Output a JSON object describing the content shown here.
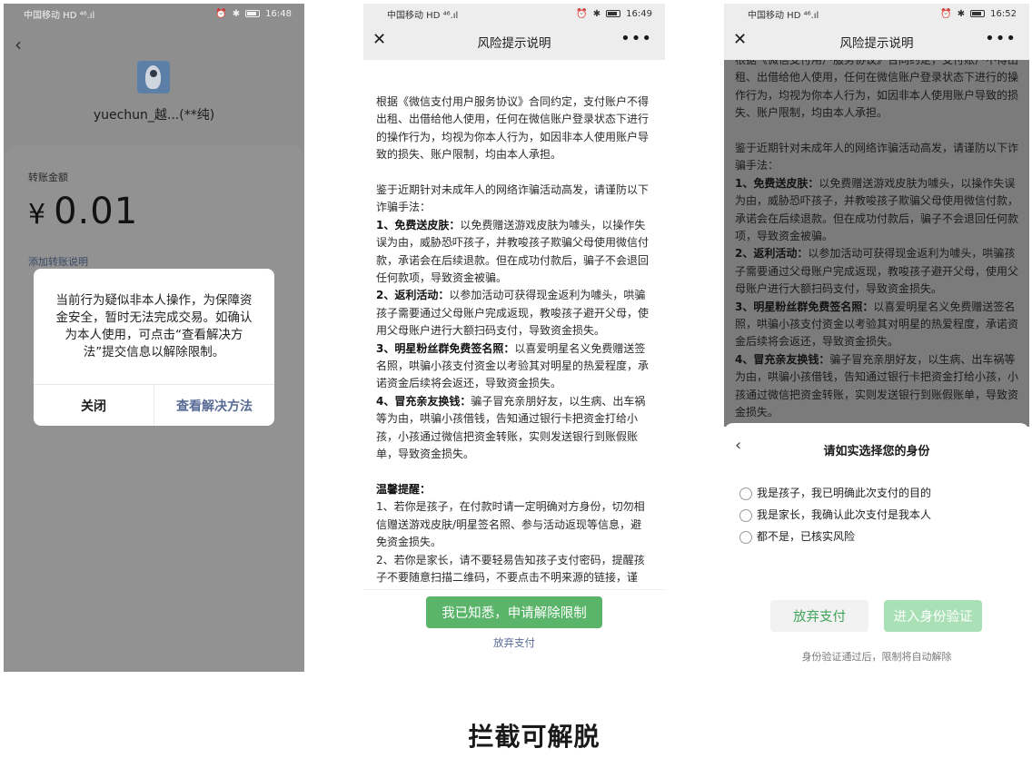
{
  "caption": "拦截可解脱",
  "phone1": {
    "status": {
      "carrier": "中国移动 HD ⁴⁶.ıl",
      "time": "16:48"
    },
    "payee_name": "yuechun_越...(**纯)",
    "amount_label": "转账金额",
    "amount_currency": "¥",
    "amount_value": "0.01",
    "add_note_link": "添加转账说明",
    "dialog": {
      "message": "当前行为疑似非本人操作，为保障资金安全，暂时无法完成交易。如确认为本人使用，可点击“查看解决方法”提交信息以解除限制。",
      "close_label": "关闭",
      "view_solution_label": "查看解决方法"
    }
  },
  "phone2": {
    "status": {
      "carrier": "中国移动 HD ⁴⁶.ıl",
      "time": "16:49"
    },
    "title": "风险提示说明",
    "more": "•••",
    "article": {
      "intro": "根据《微信支付用户服务协议》合同约定，支付账户不得出租、出借给他人使用，任何在微信账户登录状态下进行的操作行为，均视为你本人行为，如因非本人使用账户导致的损失、账户限制，均由本人承担。",
      "warn": "鉴于近期针对未成年人的网络诈骗活动高发，请谨防以下诈骗手法：",
      "item1_title": "1、免费送皮肤：",
      "item1_body": "以免费赠送游戏皮肤为噱头，以操作失误为由，威胁恐吓孩子，并教唆孩子欺骗父母使用微信付款，承诺会在后续退款。但在成功付款后，骗子不会退回任何款项，导致资金被骗。",
      "item2_title": "2、返利活动：",
      "item2_body": "以参加活动可获得现金返利为噱头，哄骗孩子需要通过父母账户完成返现，教唆孩子避开父母，使用父母账户进行大额扫码支付，导致资金损失。",
      "item3_title": "3、明星粉丝群免费签名照：",
      "item3_body": "以喜爱明星名义免费赠送签名照，哄骗小孩支付资金以考验其对明星的热爱程度，承诺资金后续将会返还，导致资金损失。",
      "item4_title": "4、冒充亲友换钱：",
      "item4_body": "骗子冒充亲朋好友，以生病、出车祸等为由，哄骗小孩借钱，告知通过银行卡把资金打给小孩，小孩通过微信把资金转账，实则发送银行到账假账单，导致资金损失。",
      "tips_title": "温馨提醒：",
      "tip1": "1、若你是孩子，在付款时请一定明确对方身份，切勿相信赠送游戏皮肤/明星签名照、参与活动返现等信息，避免资金损失。",
      "tip2": "2、若你是家长，请不要轻易告知孩子支付密码，提醒孩子不要随意扫描二维码，不要点击不明来源的链接，谨"
    },
    "primary_button": "我已知悉，申请解除限制",
    "abandon_link": "放弃支付"
  },
  "phone3": {
    "status": {
      "carrier": "中国移动 HD ⁴⁶.ıl",
      "time": "16:52"
    },
    "title": "风险提示说明",
    "more": "•••",
    "sheet": {
      "title": "请如实选择您的身份",
      "options": [
        "我是孩子，我已明确此次支付的目的",
        "我是家长，我确认此次支付是我本人",
        "都不是，已核实风险"
      ],
      "abandon_button": "放弃支付",
      "verify_button": "进入身份验证",
      "note": "身份验证通过后，限制将自动解除"
    }
  }
}
